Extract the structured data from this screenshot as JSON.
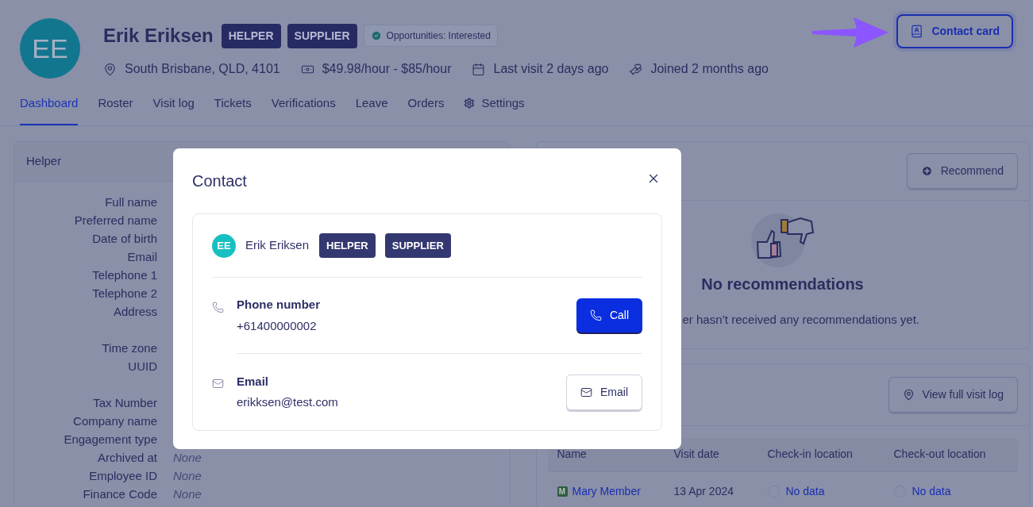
{
  "profile": {
    "initials": "EE",
    "name": "Erik Eriksen",
    "badges": [
      "HELPER",
      "SUPPLIER"
    ],
    "status": "Opportunities: Interested",
    "meta": [
      {
        "kind": "location",
        "text": "South Brisbane, QLD, 4101"
      },
      {
        "kind": "rate",
        "text": "$49.98/hour - $85/hour"
      },
      {
        "kind": "visit",
        "text": "Last visit 2 days ago"
      },
      {
        "kind": "joined",
        "text": "Joined 2 months ago"
      }
    ]
  },
  "contact_card_button": "Contact card",
  "tabs": [
    {
      "label": "Dashboard",
      "selected": true,
      "kind": "plain"
    },
    {
      "label": "Roster",
      "selected": false,
      "kind": "plain"
    },
    {
      "label": "Visit log",
      "selected": false,
      "kind": "plain"
    },
    {
      "label": "Tickets",
      "selected": false,
      "kind": "plain"
    },
    {
      "label": "Verifications",
      "selected": false,
      "kind": "plain"
    },
    {
      "label": "Leave",
      "selected": false,
      "kind": "plain"
    },
    {
      "label": "Orders",
      "selected": false,
      "kind": "plain"
    },
    {
      "label": "Settings",
      "selected": false,
      "kind": "settings"
    }
  ],
  "helper_panel": {
    "title": "Helper",
    "fields": [
      {
        "label": "Full name",
        "kind": "single"
      },
      {
        "label": "Preferred name",
        "kind": "single"
      },
      {
        "label": "Date of birth",
        "kind": "single"
      },
      {
        "label": "Email",
        "kind": "single"
      },
      {
        "label": "Telephone 1",
        "kind": "single"
      },
      {
        "label": "Telephone 2",
        "kind": "single"
      },
      {
        "label": "Address",
        "kind": "multiline"
      },
      {
        "label": "Time zone",
        "kind": "single"
      },
      {
        "label": "UUID",
        "kind": "multiline"
      },
      {
        "label": "Tax Number",
        "kind": "single"
      },
      {
        "label": "Company name",
        "kind": "single"
      },
      {
        "label": "Engagement type",
        "kind": "single"
      },
      {
        "label": "Archived at",
        "kind": "single",
        "value": "None",
        "empty": true
      },
      {
        "label": "Employee ID",
        "kind": "single",
        "value": "None",
        "empty": true
      },
      {
        "label": "Finance Code",
        "kind": "single",
        "value": "None",
        "empty": true
      }
    ]
  },
  "recommendations": {
    "button": "Recommend",
    "title": "No recommendations",
    "text": "er hasn’t received any recommendations yet."
  },
  "visits": {
    "button": "View full visit log",
    "columns": [
      "Name",
      "Visit date",
      "Check-in location",
      "Check-out location"
    ],
    "rows": [
      {
        "badge": "M",
        "name": "Mary Member",
        "date": "13 Apr 2024",
        "check_in": "No data",
        "check_out": "No data"
      }
    ]
  },
  "modal": {
    "title": "Contact",
    "person": {
      "initials": "EE",
      "name": "Erik Eriksen",
      "badges": [
        "HELPER",
        "SUPPLIER"
      ]
    },
    "rows": [
      {
        "kind": "phone",
        "label": "Phone number",
        "value": "+61400000002",
        "action": "Call"
      },
      {
        "kind": "email",
        "label": "Email",
        "value": "erikksen@test.com",
        "action": "Email"
      }
    ]
  }
}
